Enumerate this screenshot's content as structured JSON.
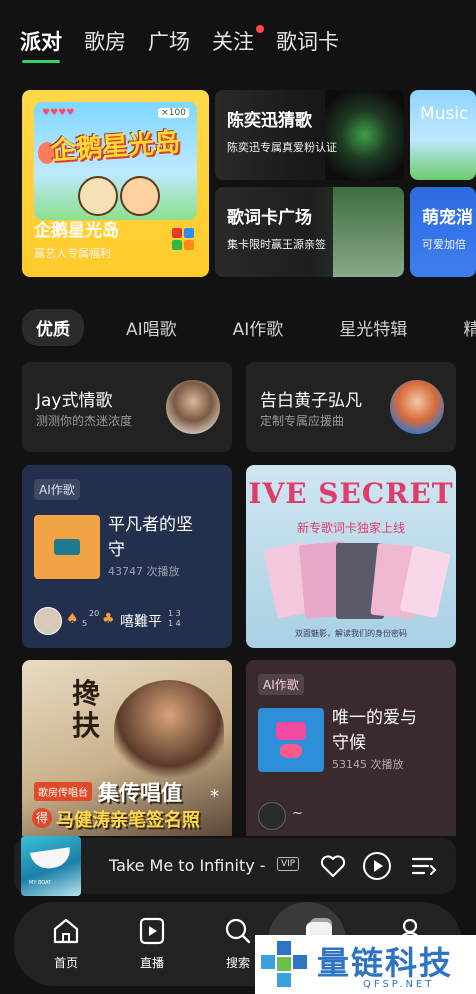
{
  "top_tabs": [
    {
      "label": "派对",
      "active": true
    },
    {
      "label": "歌房"
    },
    {
      "label": "广场"
    },
    {
      "label": "关注",
      "has_dot": true
    },
    {
      "label": "歌词卡"
    }
  ],
  "banners": {
    "main": {
      "logo_text": "企鹅星光岛",
      "title": "企鹅星光岛",
      "subtitle": "赢艺人专属福利",
      "counter": "×100"
    },
    "b1": {
      "title": "陈奕迅猜歌",
      "subtitle": "陈奕迅专属真爱粉认证"
    },
    "b2": {
      "title": "歌词卡广场",
      "subtitle": "集卡限时赢王源亲签"
    },
    "b3": {
      "title": "Music"
    },
    "b4": {
      "title": "萌宠消",
      "subtitle": "可爱加倍"
    }
  },
  "filters": [
    "优质",
    "AI唱歌",
    "AI作歌",
    "星光特辑",
    "精选"
  ],
  "cards_small": [
    {
      "title": "Jay式情歌",
      "subtitle": "测测你的杰迷浓度"
    },
    {
      "title": "告白黄子弘凡",
      "subtitle": "定制专属应援曲"
    }
  ],
  "card_ai1": {
    "tag": "AI作歌",
    "title_line1": "平凡者的坚",
    "title_line2": "守",
    "plays": "43747 次播放",
    "user": "嘻難平",
    "sup1": "5",
    "sup2": "20",
    "sup3": "1 3",
    "sup4": "1 4"
  },
  "card_ive": {
    "title": "IVE SECRET",
    "subtitle": "新专歌词卡独家上线",
    "footer": "双面魅影，解读我们的身份密码"
  },
  "card_poster": {
    "calligraphy": "搀扶",
    "badge_top": "歌房传唱台",
    "headline": "集传唱值",
    "badge_left": "得",
    "line2": "马健涛亲笔签名照",
    "star": "*"
  },
  "card_ai2": {
    "tag": "AI作歌",
    "title_line1": "唯一的爱与",
    "title_line2": "守候",
    "plays": "53145 次播放",
    "user": "~"
  },
  "player": {
    "title": "Take Me to Infinity -",
    "vip": "VIP",
    "cover_text": "MY BOAT"
  },
  "bottom_nav": [
    {
      "label": "首页",
      "icon": "home-icon"
    },
    {
      "label": "直播",
      "icon": "live-icon"
    },
    {
      "label": "搜索",
      "icon": "search-icon"
    },
    {
      "label": "",
      "icon": "create-icon"
    },
    {
      "label": "",
      "icon": "profile-icon"
    }
  ],
  "watermark": {
    "text": "量链科技",
    "sub": "QFSP.NET"
  },
  "colors": {
    "background": "#121212",
    "accent": "#2fd16a",
    "card": "#222222",
    "ai_card_blue": "#23304d",
    "ai_card_brown": "#3a2a2e",
    "watermark": "#2e73c4"
  }
}
